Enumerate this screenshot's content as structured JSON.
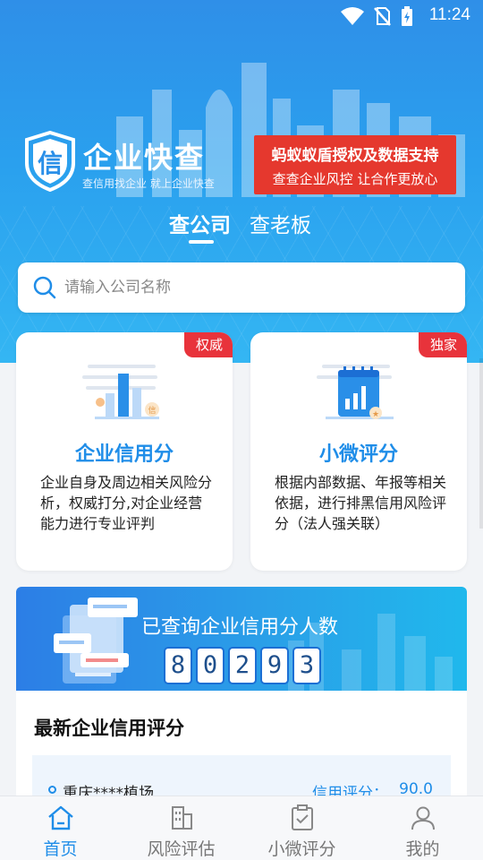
{
  "status_bar": {
    "time": "11:24",
    "icons": [
      "wifi-icon",
      "no-sim-icon",
      "battery-icon"
    ]
  },
  "brand": {
    "title": "企业快查",
    "subtitle": "查信用找企业 就上企业快查",
    "logo_char": "信"
  },
  "promo": {
    "line1": "蚂蚁蚁盾授权及数据支持",
    "line2": "查查企业风控 让合作更放心"
  },
  "tabs": [
    {
      "label": "查公司",
      "active": true
    },
    {
      "label": "查老板",
      "active": false
    }
  ],
  "search": {
    "placeholder": "请输入公司名称",
    "value": ""
  },
  "cards": [
    {
      "title": "企业信用分",
      "badge": "权威",
      "desc": "企业自身及周边相关风险分析，权威打分,对企业经营能力进行专业评判"
    },
    {
      "title": "小微评分",
      "badge": "独家",
      "desc": "根据内部数据、年报等相关依据，进行排黑信用风险评分（法人强关联）"
    }
  ],
  "counter": {
    "label": "已查询企业信用分人数",
    "digits": [
      "8",
      "0",
      "2",
      "9",
      "3"
    ]
  },
  "latest": {
    "title": "最新企业信用评分",
    "rows": [
      {
        "name": "重庆****植场",
        "score_label": "信用评分：",
        "score": "90.0"
      }
    ]
  },
  "bottom_nav": [
    {
      "label": "首页",
      "icon": "home-icon",
      "active": true
    },
    {
      "label": "风险评估",
      "icon": "building-icon",
      "active": false
    },
    {
      "label": "小微评分",
      "icon": "clipboard-icon",
      "active": false
    },
    {
      "label": "我的",
      "icon": "user-icon",
      "active": false
    }
  ],
  "colors": {
    "primary": "#1f8de8",
    "badge_red": "#e8333b",
    "promo_red": "#e5382e"
  }
}
